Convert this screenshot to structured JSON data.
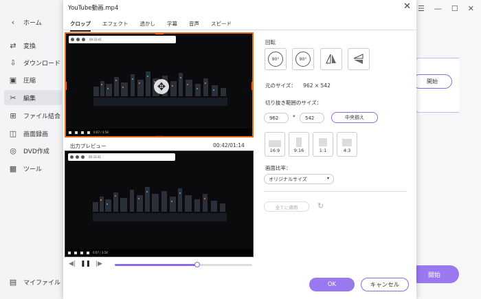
{
  "sidebar": {
    "back_icon": "chevron-left-icon",
    "home": "ホーム",
    "items": [
      {
        "label": "変換",
        "icon": "convert-icon"
      },
      {
        "label": "ダウンロード",
        "icon": "download-icon"
      },
      {
        "label": "圧縮",
        "icon": "compress-icon"
      },
      {
        "label": "編集",
        "icon": "scissors-icon"
      },
      {
        "label": "ファイル結合",
        "icon": "merge-icon"
      },
      {
        "label": "画面録画",
        "icon": "record-icon"
      },
      {
        "label": "DVD作成",
        "icon": "dvd-icon"
      },
      {
        "label": "ツール",
        "icon": "tools-icon"
      }
    ],
    "my_files": "マイファイル",
    "active_item": "編集"
  },
  "background": {
    "start_small": "開始",
    "start_big": "開始",
    "accent_color": "#9a78ef"
  },
  "dialog": {
    "title": "YouTube動画.mp4",
    "tabs": [
      "クロップ",
      "エフェクト",
      "透かし",
      "字幕",
      "音声",
      "スピード"
    ],
    "active_tab": "クロップ",
    "preview_label": "出力プレビュー",
    "preview_time": "00:42/01:14",
    "playback_progress": 0.6,
    "rotate_label": "回転",
    "rotate_buttons": [
      "90°",
      "90°"
    ],
    "original_size_label": "元のサイズ：",
    "original_size_value": "962 × 542",
    "crop_size_label": "切り抜き範囲のサイズ：",
    "crop_width": "962",
    "crop_separator": "*",
    "crop_height": "542",
    "center_button": "中央揃え",
    "ratios": [
      "16:9",
      "9:16",
      "1:1",
      "4:3"
    ],
    "aspect_label": "画面比率：",
    "aspect_value": "オリジナルサイズ",
    "apply_all": "全てに適用",
    "ok": "OK",
    "cancel": "キャンセル",
    "crop_border_color": "#f06a1b"
  }
}
